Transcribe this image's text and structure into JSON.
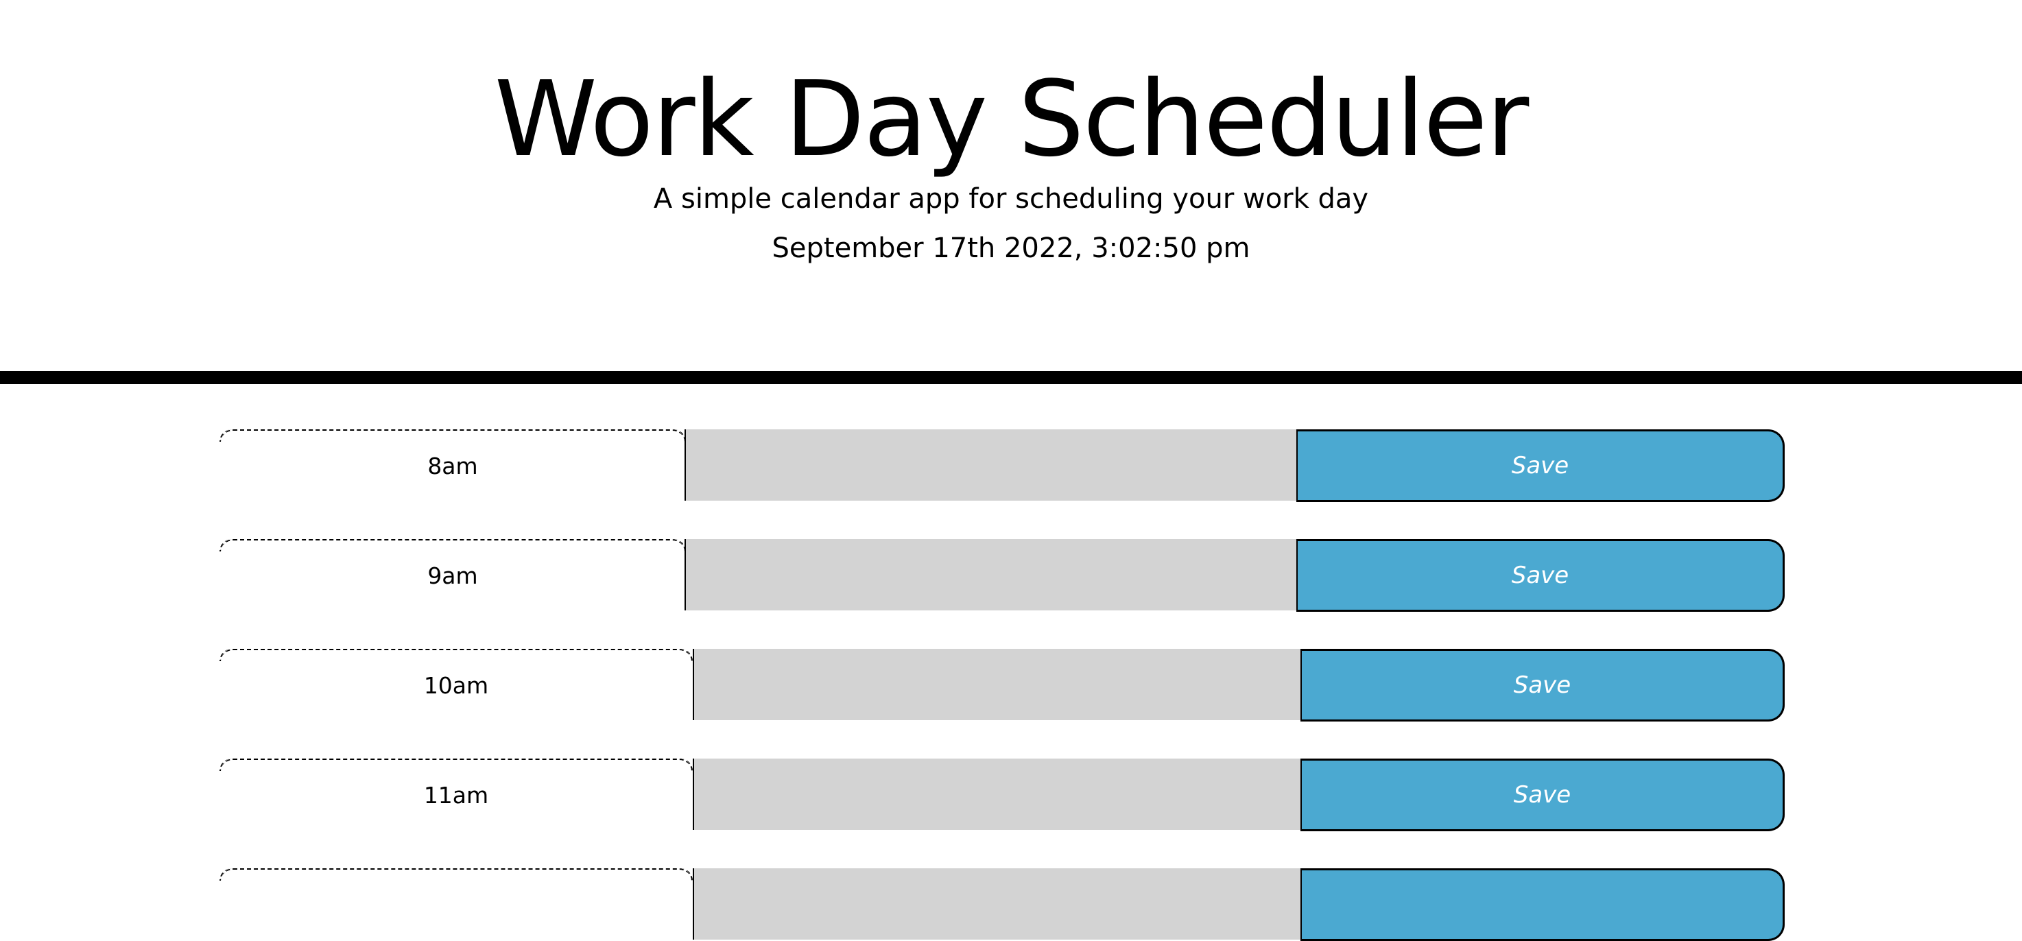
{
  "header": {
    "title": "Work Day Scheduler",
    "subtitle": "A simple calendar app for scheduling your work day",
    "current_day": "September 17th 2022, 3:02:50 pm"
  },
  "time_blocks": [
    {
      "hour": "8am",
      "text": "",
      "save_label": "Save"
    },
    {
      "hour": "9am",
      "text": "",
      "save_label": "Save"
    },
    {
      "hour": "10am",
      "text": "",
      "save_label": "Save"
    },
    {
      "hour": "11am",
      "text": "",
      "save_label": "Save"
    },
    {
      "hour": "",
      "text": "",
      "save_label": ""
    }
  ],
  "colors": {
    "past": "#d3d3d3",
    "save_button": "#4ba9d1",
    "save_text": "#ffffff",
    "divider": "#000000"
  }
}
